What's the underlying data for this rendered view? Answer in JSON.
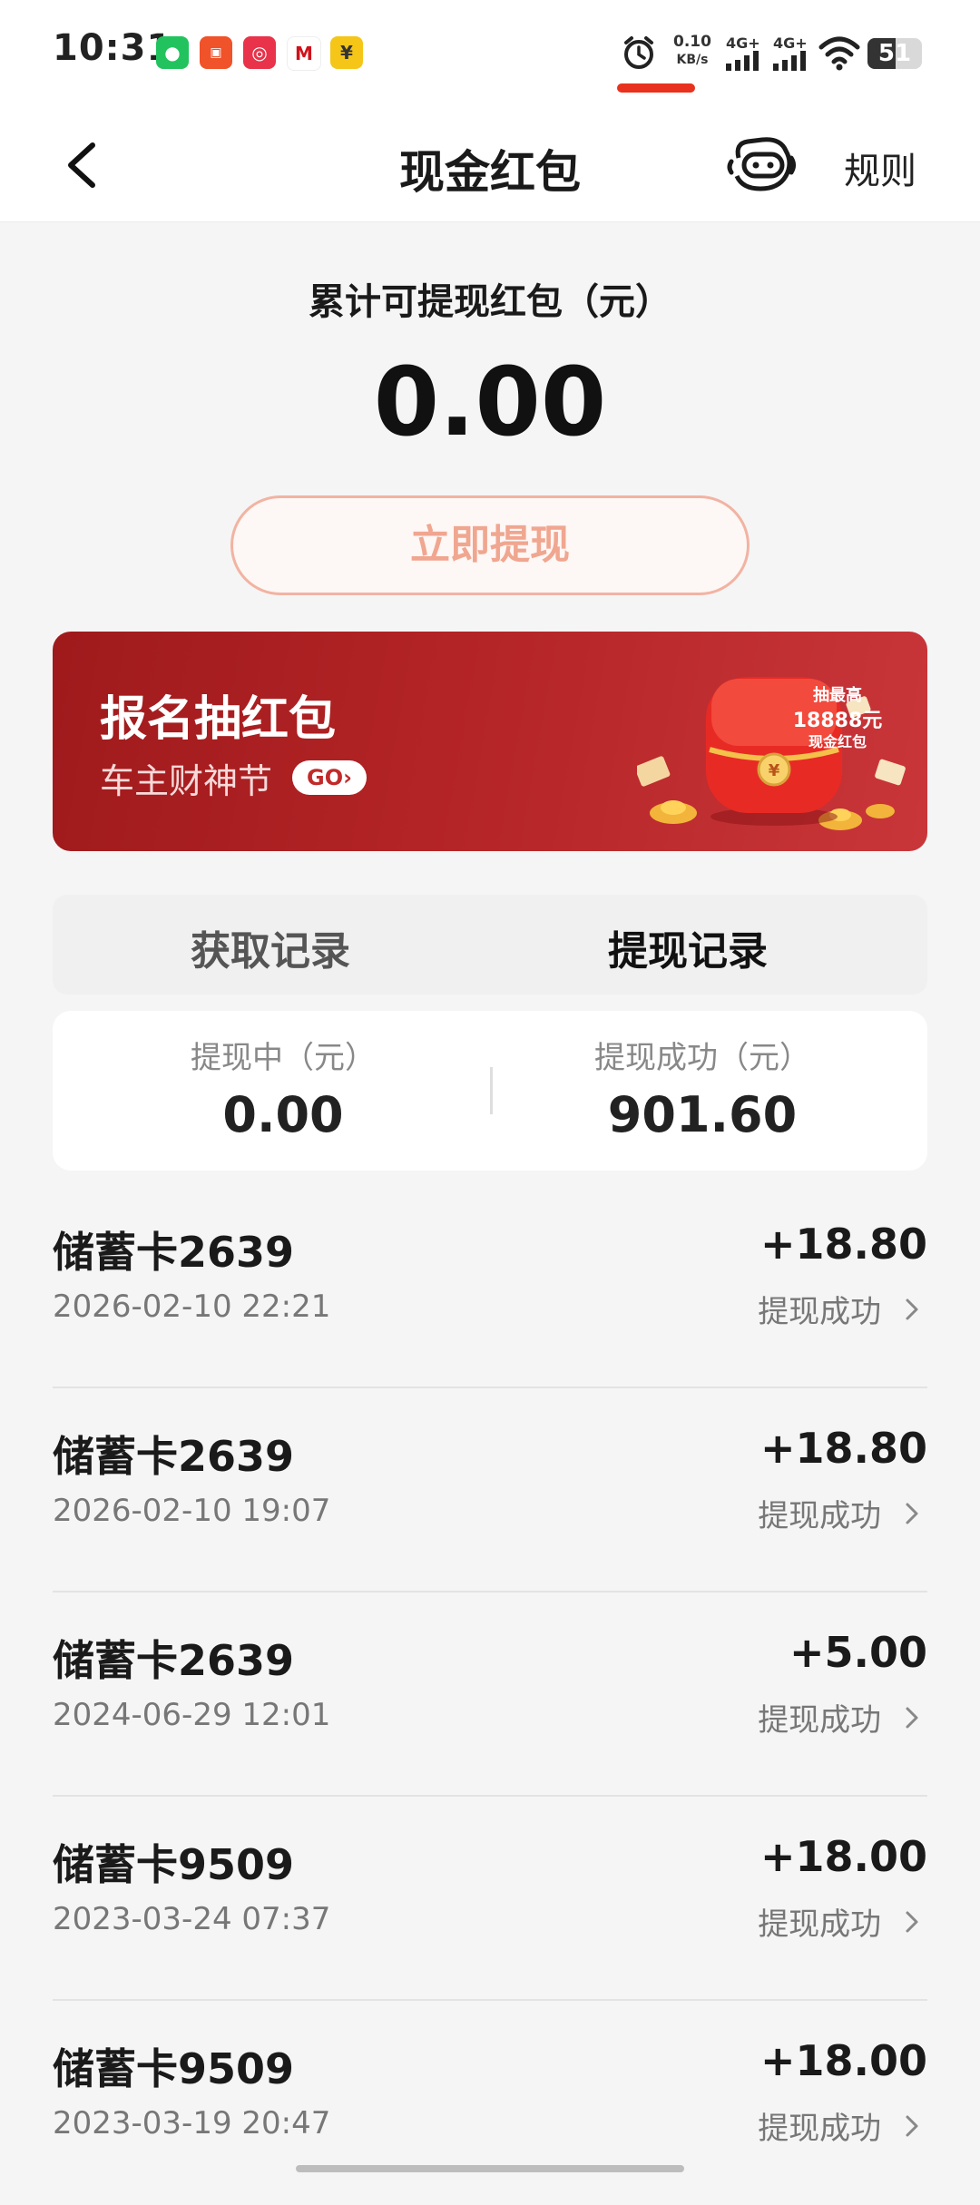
{
  "status_bar": {
    "time": "10:31",
    "net_speed_value": "0.10",
    "net_speed_unit": "KB/s",
    "signal_1": "4G+",
    "signal_2": "4G+",
    "battery": "51",
    "battery_level": 0.51
  },
  "header": {
    "title": "现金红包",
    "rules_label": "规则"
  },
  "balance": {
    "label": "累计可提现红包（元）",
    "amount": "0.00",
    "withdraw_button": "立即提现"
  },
  "banner": {
    "title": "报名抽红包",
    "subtitle": "车主财神节",
    "go_label": "GO",
    "promo_line1": "抽最高",
    "promo_line2": "18888元",
    "promo_line3": "现金红包"
  },
  "tabs": [
    {
      "label": "获取记录",
      "active": false
    },
    {
      "label": "提现记录",
      "active": true
    }
  ],
  "summary": {
    "pending_label": "提现中（元）",
    "pending_value": "0.00",
    "success_label": "提现成功（元）",
    "success_value": "901.60"
  },
  "records": [
    {
      "card": "储蓄卡2639",
      "time": "2026-02-10 22:21",
      "amount": "+18.80",
      "status": "提现成功"
    },
    {
      "card": "储蓄卡2639",
      "time": "2026-02-10 19:07",
      "amount": "+18.80",
      "status": "提现成功"
    },
    {
      "card": "储蓄卡2639",
      "time": "2024-06-29 12:01",
      "amount": "+5.00",
      "status": "提现成功"
    },
    {
      "card": "储蓄卡9509",
      "time": "2023-03-24 07:37",
      "amount": "+18.00",
      "status": "提现成功"
    },
    {
      "card": "储蓄卡9509",
      "time": "2023-03-19 20:47",
      "amount": "+18.00",
      "status": "提现成功"
    }
  ],
  "colors": {
    "accent": "#e8321f",
    "banner_red": "#b32426",
    "withdraw_button_text": "#f0a68f"
  },
  "icons": [
    "back-icon",
    "robot-service-icon",
    "chevron-right-icon",
    "alarm-icon",
    "wifi-icon",
    "signal-icon"
  ]
}
